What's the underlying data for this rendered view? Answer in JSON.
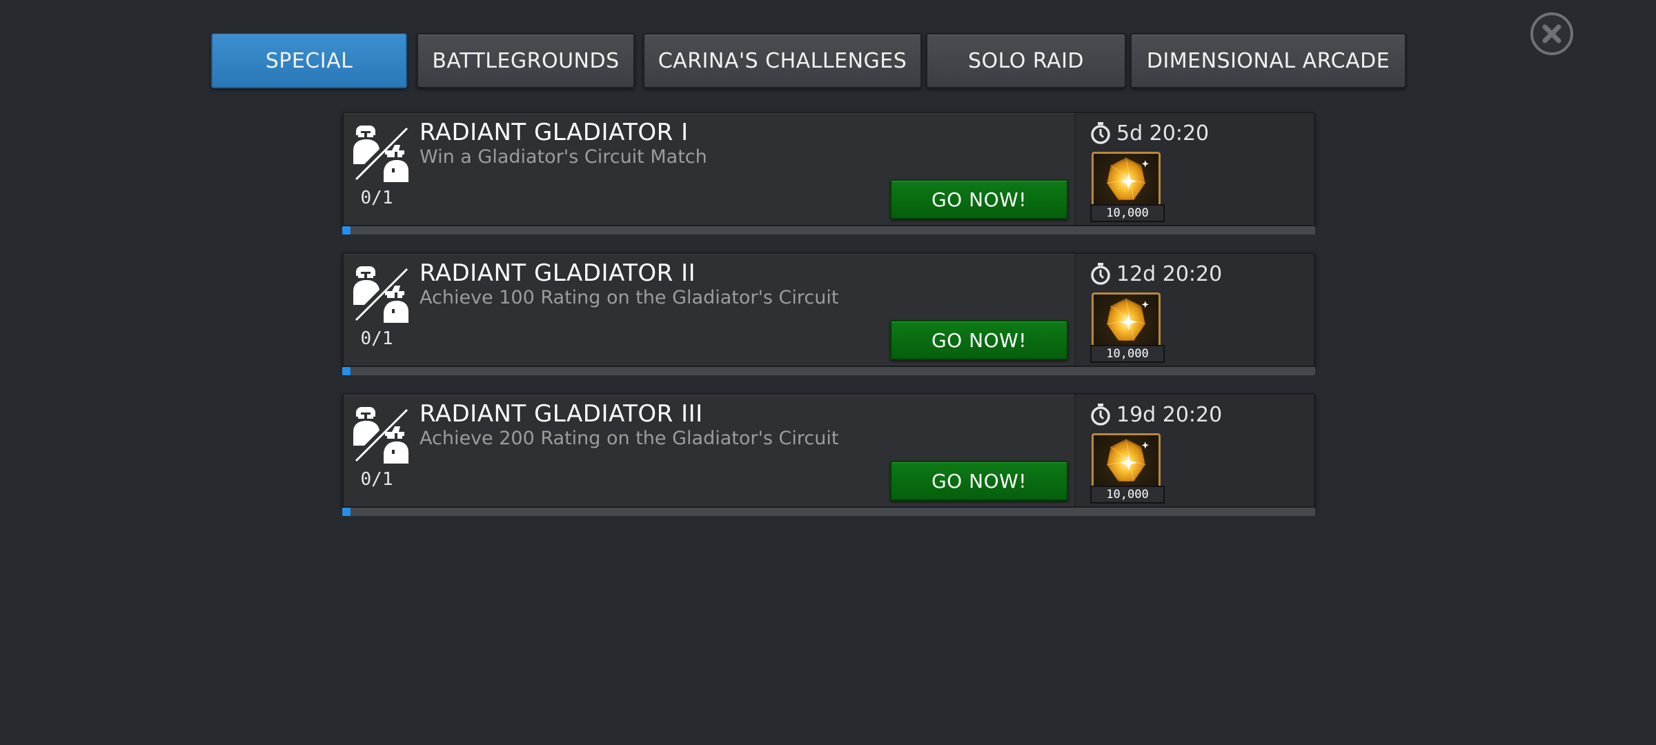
{
  "tabs": [
    {
      "label": "SPECIAL",
      "active": true
    },
    {
      "label": "BATTLEGROUNDS",
      "active": false
    },
    {
      "label": "CARINA'S CHALLENGES",
      "active": false
    },
    {
      "label": "SOLO RAID",
      "active": false
    },
    {
      "label": "DIMENSIONAL ARCADE",
      "active": false
    }
  ],
  "close_icon": "close-x-circle-icon",
  "quests": [
    {
      "title": "RADIANT GLADIATOR I",
      "description": "Win a Gladiator's Circuit Match",
      "progress": "0/1",
      "progress_fraction": 0,
      "button": "GO NOW!",
      "timer": "5d 20:20",
      "reward_icon": "gold-crystal-icon",
      "reward_quantity": "10,000"
    },
    {
      "title": "RADIANT GLADIATOR II",
      "description": "Achieve 100 Rating on the Gladiator's Circuit",
      "progress": "0/1",
      "progress_fraction": 0,
      "button": "GO NOW!",
      "timer": "12d 20:20",
      "reward_icon": "gold-crystal-icon",
      "reward_quantity": "10,000"
    },
    {
      "title": "RADIANT GLADIATOR III",
      "description": "Achieve 200 Rating on the Gladiator's Circuit",
      "progress": "0/1",
      "progress_fraction": 0,
      "button": "GO NOW!",
      "timer": "19d 20:20",
      "reward_icon": "gold-crystal-icon",
      "reward_quantity": "10,000"
    }
  ],
  "colors": {
    "background": "#272a2f",
    "tab_active": "#2f82c3",
    "go_button": "#08700f",
    "progress": "#2290ec",
    "reward_frame": "#b8893a"
  }
}
